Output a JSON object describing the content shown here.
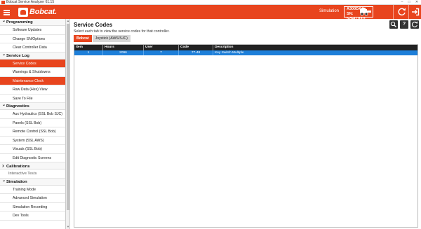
{
  "window": {
    "title": "Bobcat Service Analyzer 61.15",
    "min": "–",
    "max": "□",
    "close": "✕"
  },
  "header": {
    "brand": "Bobcat.",
    "mode_label": "Simulation",
    "device_model": "A300DAA",
    "device_sn": "SN: 526411001",
    "accent": "#e8451e"
  },
  "sidebar": {
    "groups": [
      {
        "label": "Programming",
        "expanded": true,
        "items": [
          "Software Updates",
          "Change SN/Options",
          "Clear Controller Data"
        ]
      },
      {
        "label": "Service Log",
        "expanded": true,
        "items": [
          "Service Codes",
          "Warnings & Shutdowns",
          "Maintenance Clock",
          "Raw Data (Hex) View",
          "Save To File"
        ]
      },
      {
        "label": "Diagnostics",
        "expanded": true,
        "items": [
          "Aux Hydraulics (SSL Bob SJC)",
          "Panels (SSL Bob)",
          "Remote Control (SSL Bob)",
          "System (SSL AWS)",
          "Visuals (SSL Bob)",
          "Edit Diagnostic Screens"
        ]
      },
      {
        "label": "Calibrations",
        "expanded": false,
        "items": []
      },
      {
        "label": "Interactive Tests",
        "expanded": false,
        "items": []
      },
      {
        "label": "Simulation",
        "expanded": true,
        "items": [
          "Training Mode",
          "Advanced Simulation",
          "Simulation Recording",
          "Dev Tools"
        ]
      }
    ],
    "active_item": "Service Codes",
    "hover_item": "Maintenance Clock"
  },
  "main": {
    "title": "Service Codes",
    "subtitle": "Select each tab to view the service codes for that controller.",
    "tabs": [
      {
        "label": "Bobcat",
        "active": true
      },
      {
        "label": "Joystick (AWS/SJC)",
        "active": false
      }
    ],
    "table": {
      "columns": [
        "Item",
        "Hours",
        "User",
        "Code",
        "Description"
      ],
      "rows": [
        [
          "1",
          "2096",
          "7",
          "77-48",
          "Key Switch Multiple"
        ]
      ]
    }
  },
  "icons": {
    "menu": "hamburger-icon",
    "search": "search-icon",
    "help": "help-icon",
    "refresh": "refresh-icon",
    "logout": "logout-icon"
  }
}
